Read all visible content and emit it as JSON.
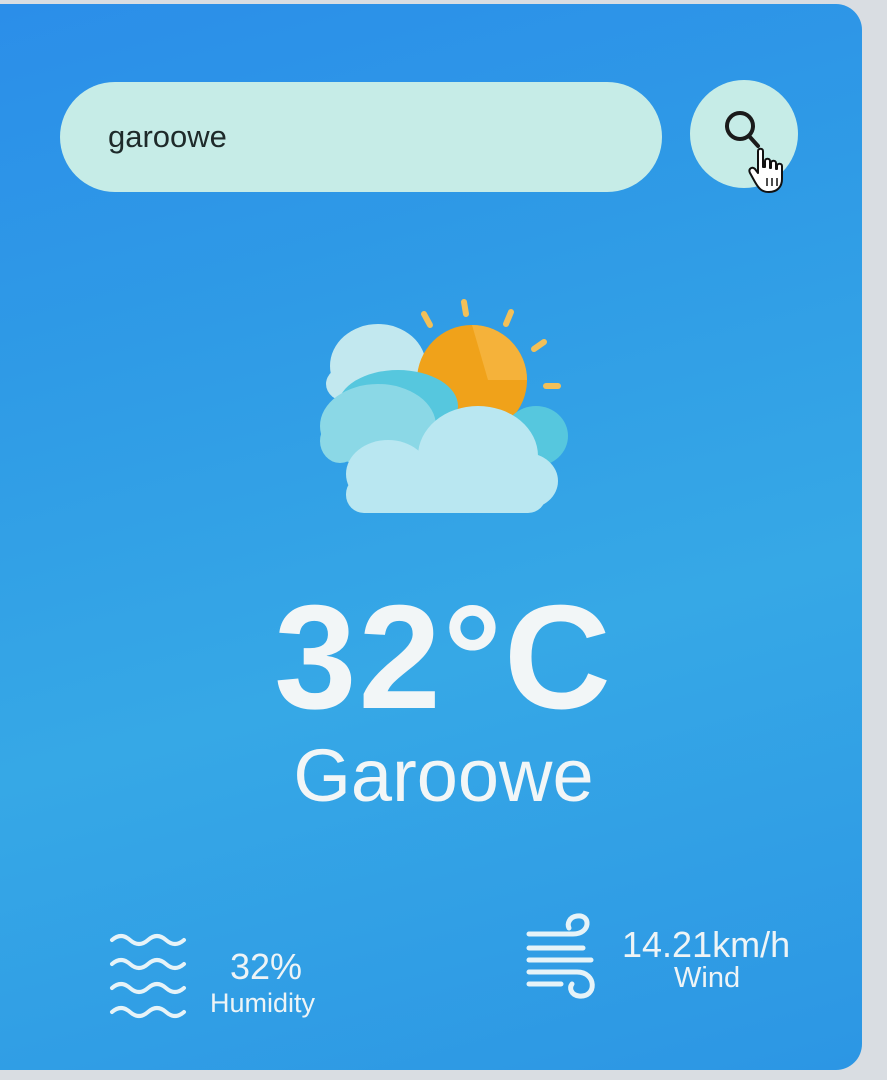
{
  "search": {
    "value": "garoowe",
    "button_icon": "search-icon"
  },
  "weather": {
    "icon": "sun-behind-clouds-icon",
    "temperature": "32°C",
    "city": "Garoowe"
  },
  "details": {
    "humidity_value": "32%",
    "humidity_label": "Humidity",
    "humidity_icon": "humidity-waves-icon",
    "wind_value": "14.21km/h",
    "wind_label": "Wind",
    "wind_icon": "wind-icon"
  },
  "colors": {
    "card_background": "#2f9be6",
    "search_background": "#c6ece7",
    "text": "#f2f6f7",
    "sun": "#f39c12"
  }
}
